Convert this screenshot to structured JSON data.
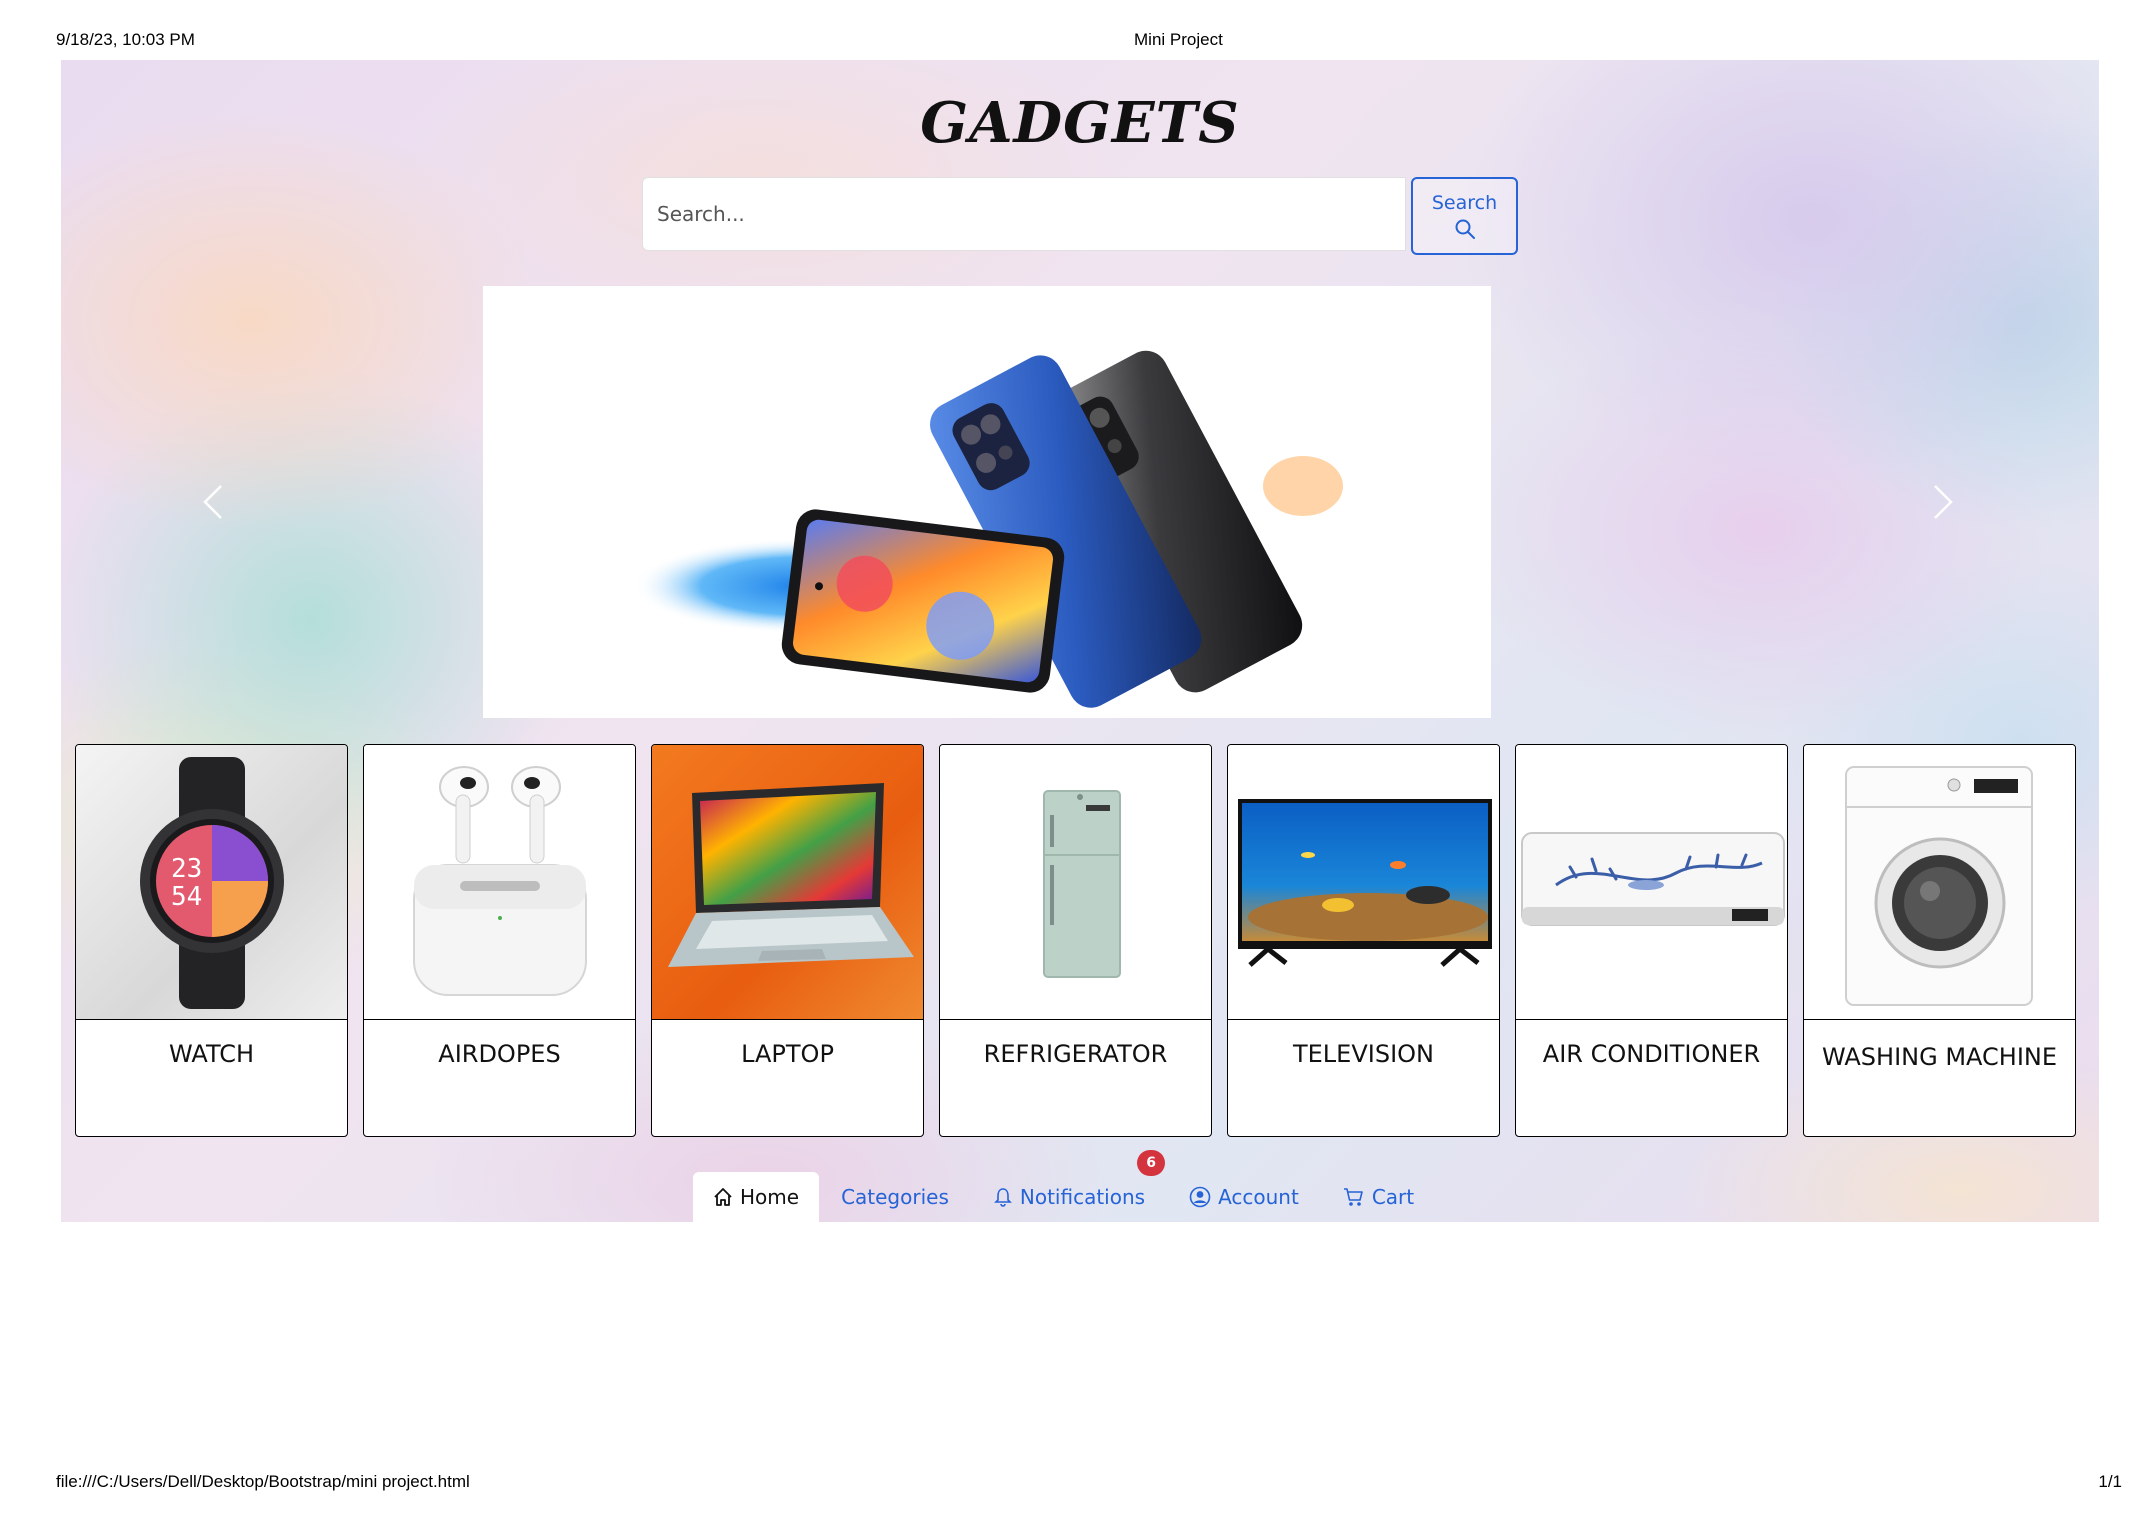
{
  "print_header": {
    "datetime": "9/18/23, 10:03 PM",
    "doc_title": "Mini Project"
  },
  "print_footer": {
    "url": "file:///C:/Users/Dell/Desktop/Bootstrap/mini project.html",
    "page": "1/1"
  },
  "site": {
    "logo": "GADGETS"
  },
  "search": {
    "placeholder": "Search...",
    "button_label": "Search"
  },
  "carousel": {
    "indicator_count": 4,
    "active_slide": 1
  },
  "products": [
    {
      "name": "WATCH"
    },
    {
      "name": "AIRDOPES"
    },
    {
      "name": "LAPTOP"
    },
    {
      "name": "REFRIGERATOR"
    },
    {
      "name": "TELEVISION"
    },
    {
      "name": "AIR CONDITIONER"
    },
    {
      "name": "WASHING MACHINE"
    }
  ],
  "nav": {
    "home": "Home",
    "categories": "Categories",
    "notifications": "Notifications",
    "notifications_badge": "6",
    "account": "Account",
    "cart": "Cart"
  },
  "colors": {
    "link_blue": "#2563d6",
    "badge_red": "#d4343e"
  }
}
